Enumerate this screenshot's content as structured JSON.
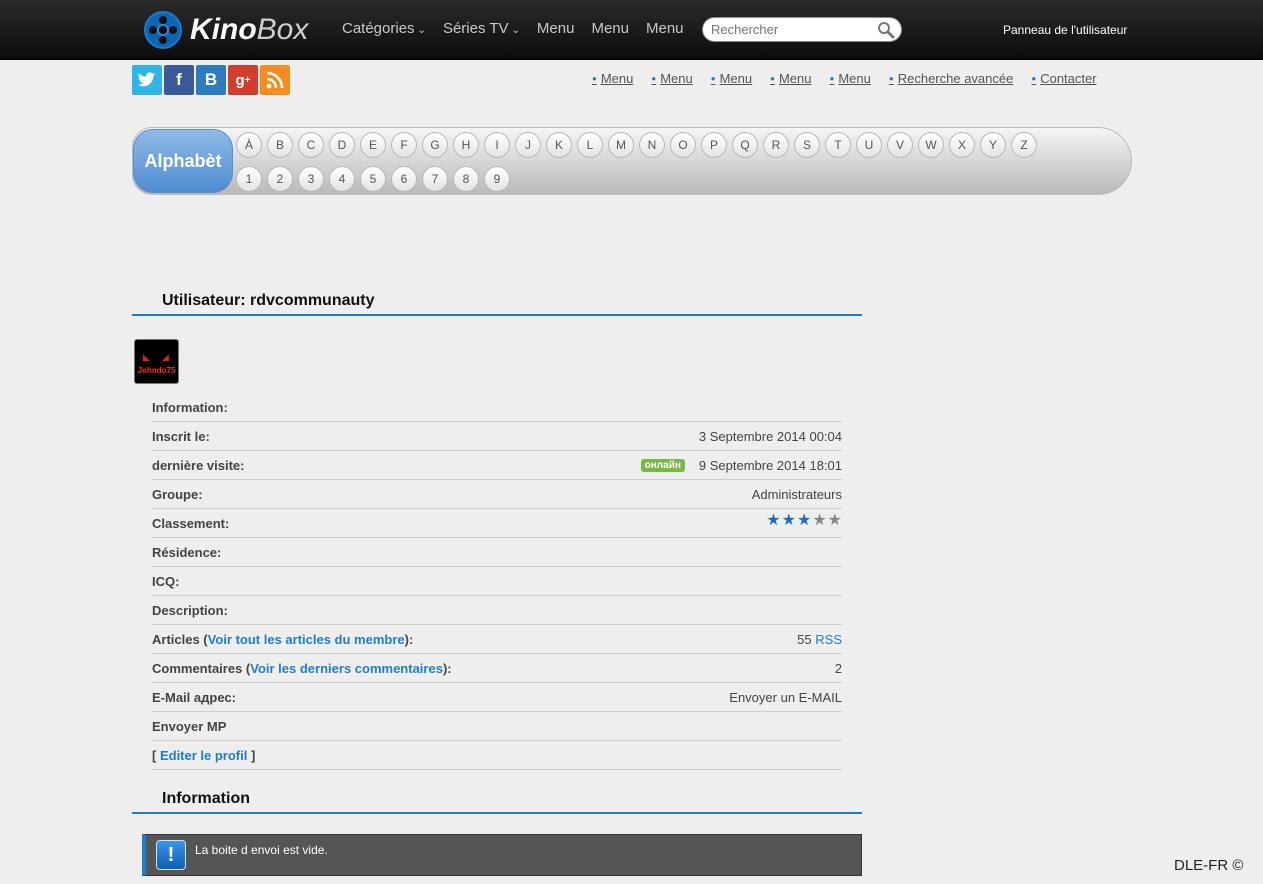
{
  "header": {
    "logo_bold": "Kino",
    "logo_light": "Box",
    "nav": [
      {
        "label": "Catégories",
        "has_dropdown": true
      },
      {
        "label": "Séries TV",
        "has_dropdown": true
      },
      {
        "label": "Menu",
        "has_dropdown": false
      },
      {
        "label": "Menu",
        "has_dropdown": false
      },
      {
        "label": "Menu",
        "has_dropdown": false
      }
    ],
    "search_placeholder": "Rechercher",
    "user_panel": "Panneau de l'utilisateur"
  },
  "social": [
    "twitter-icon",
    "facebook-icon",
    "vk-icon",
    "google-plus-icon",
    "rss-icon"
  ],
  "submenu": [
    "Menu",
    "Menu",
    "Menu",
    "Menu",
    "Menu",
    "Recherche avancée",
    "Contacter"
  ],
  "alphabet": {
    "label": "Alphabèt",
    "letters": [
      "À",
      "B",
      "C",
      "D",
      "E",
      "F",
      "G",
      "H",
      "I",
      "J",
      "K",
      "L",
      "M",
      "N",
      "O",
      "P",
      "Q",
      "R",
      "S",
      "T",
      "U",
      "V",
      "W",
      "X",
      "Y",
      "Z"
    ],
    "digits": [
      "1",
      "2",
      "3",
      "4",
      "5",
      "6",
      "7",
      "8",
      "9"
    ]
  },
  "profile": {
    "title": "Utilisateur: rdvcommunauty",
    "avatar_text": "Johndo75",
    "rows": {
      "information": "Information:",
      "registered_label": "Inscrit le:",
      "registered_value": "3 Septembre 2014 00:04",
      "last_visit_label": "dernière visite:",
      "online_badge": "онлайн",
      "last_visit_value": "9 Septembre 2014 18:01",
      "group_label": "Groupe:",
      "group_value": "Administrateurs",
      "rating_label": "Classement:",
      "rating": 3,
      "rating_max": 5,
      "residence_label": "Résidence:",
      "icq_label": "ICQ:",
      "description_label": "Description:",
      "articles_prefix": "Articles (",
      "articles_link": "Voir tout les articles du membre",
      "articles_suffix": "):",
      "articles_count": "55",
      "rss": "RSS",
      "comments_prefix": "Commentaires (",
      "comments_link": "Voir les derniers commentaires",
      "comments_suffix": "):",
      "comments_count": "2",
      "email_label": "E-Mail адрес:",
      "email_link": "Envoyer un E-MAIL",
      "send_pm": "Envoyer MP",
      "edit_profile": "Editer le profil"
    }
  },
  "information": {
    "title": "Information",
    "message": "La boite d envoi est vide."
  },
  "footer_credit": "DLE-FR ©"
}
